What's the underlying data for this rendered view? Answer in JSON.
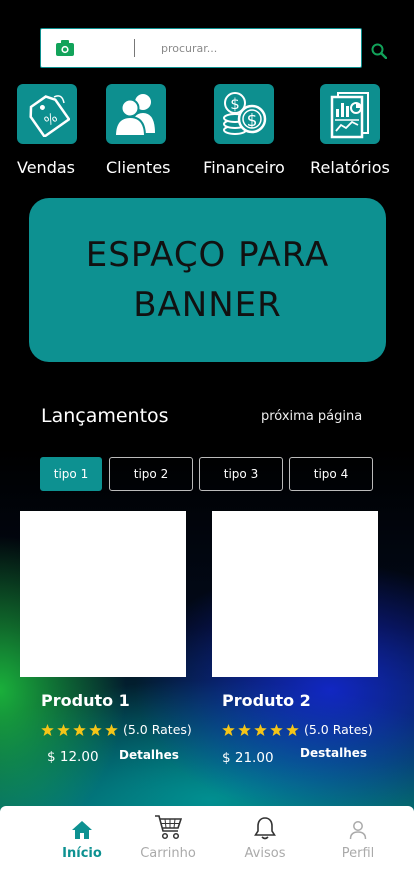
{
  "search": {
    "placeholder": "procurar..."
  },
  "categories": [
    {
      "label": "Vendas",
      "icon": "sales-tag-icon"
    },
    {
      "label": "Clientes",
      "icon": "users-icon"
    },
    {
      "label": "Financeiro",
      "icon": "coins-icon"
    },
    {
      "label": "Relatórios",
      "icon": "report-icon"
    }
  ],
  "banner": {
    "line1": "ESPAÇO PARA",
    "line2": "BANNER"
  },
  "section": {
    "title": "Lançamentos",
    "next_page": "próxima página"
  },
  "tabs": [
    {
      "label": "tipo 1",
      "active": true
    },
    {
      "label": "tipo 2",
      "active": false
    },
    {
      "label": "tipo 3",
      "active": false
    },
    {
      "label": "tipo 4",
      "active": false
    }
  ],
  "products": [
    {
      "name": "Produto 1",
      "rating": 5,
      "rates": "(5.0 Rates)",
      "price": "$ 12.00",
      "details": "Detalhes"
    },
    {
      "name": "Produto 2",
      "rating": 5,
      "rates": "(5.0 Rates)",
      "price": "$ 21.00",
      "details": "Destalhes"
    }
  ],
  "nav": [
    {
      "label": "Início",
      "icon": "home-icon",
      "active": true
    },
    {
      "label": "Carrinho",
      "icon": "cart-icon",
      "active": false
    },
    {
      "label": "Avisos",
      "icon": "bell-icon",
      "active": false
    },
    {
      "label": "Perfil",
      "icon": "user-icon",
      "active": false
    }
  ],
  "colors": {
    "accent": "#0d9191",
    "star": "#f5c518"
  }
}
